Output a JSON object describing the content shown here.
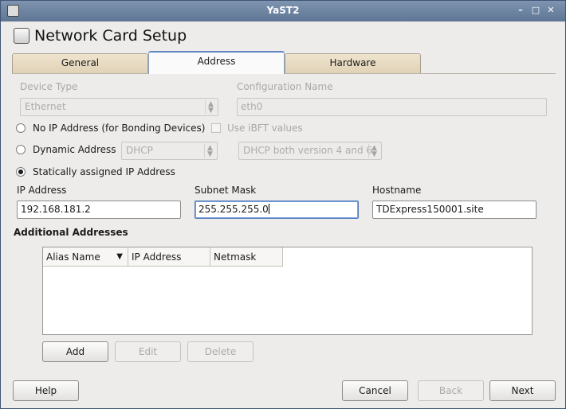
{
  "window": {
    "title": "YaST2",
    "controls": {
      "minimize": "–",
      "maximize": "□",
      "close": "✕"
    }
  },
  "header": {
    "title": "Network Card Setup",
    "icon": "network-card-icon"
  },
  "tabs": [
    {
      "label": "General"
    },
    {
      "label": "Address"
    },
    {
      "label": "Hardware"
    }
  ],
  "device_type": {
    "label": "Device Type",
    "value": "Ethernet"
  },
  "configuration_name": {
    "label": "Configuration Name",
    "value": "eth0"
  },
  "mode": {
    "no_ip_label": "No IP Address (for Bonding Devices)",
    "use_ibft_label": "Use iBFT values",
    "dynamic_label": "Dynamic Address",
    "dynamic_method": "DHCP",
    "dhcp_version": "DHCP both version 4 and 6",
    "static_label": "Statically assigned IP Address",
    "selected": "static"
  },
  "ip_address": {
    "label": "IP Address",
    "value": "192.168.181.2"
  },
  "subnet_mask": {
    "label": "Subnet Mask",
    "value": "255.255.255.0"
  },
  "hostname": {
    "label": "Hostname",
    "value": "TDExpress150001.site"
  },
  "additional": {
    "title": "Additional Addresses",
    "columns": [
      "Alias Name",
      "IP Address",
      "Netmask"
    ],
    "rows": [],
    "add_label": "Add",
    "edit_label": "Edit",
    "delete_label": "Delete"
  },
  "footer": {
    "help_label": "Help",
    "cancel_label": "Cancel",
    "back_label": "Back",
    "next_label": "Next"
  }
}
